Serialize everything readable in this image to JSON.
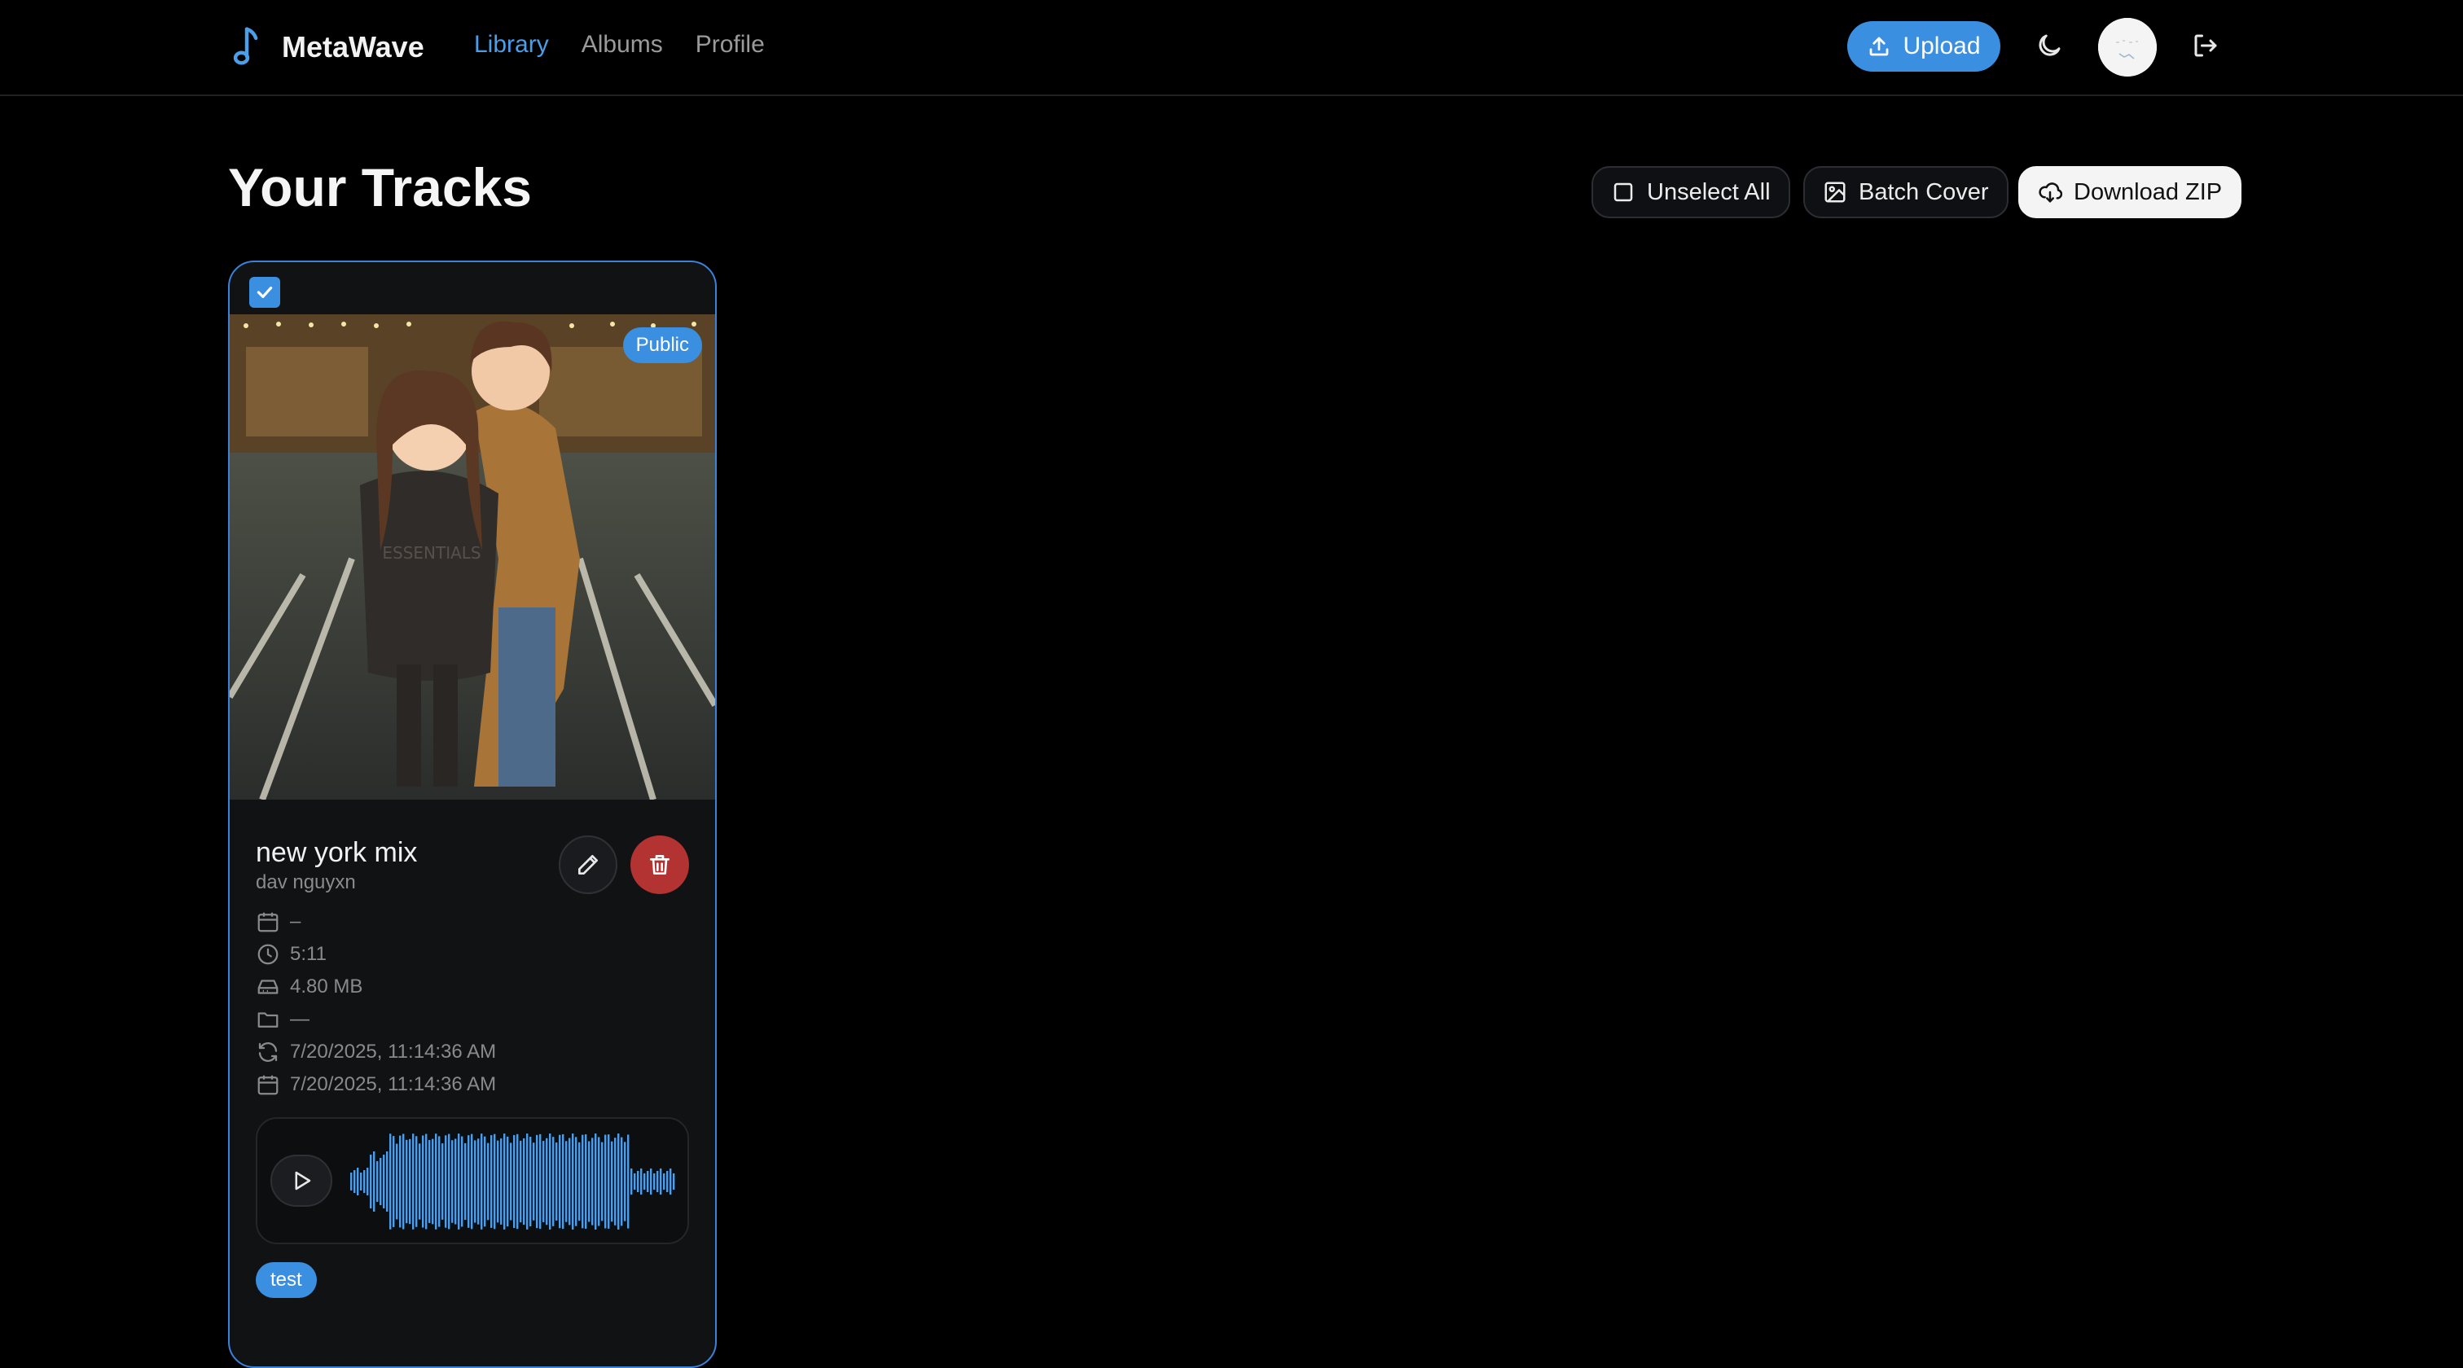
{
  "app": {
    "brand": "MetaWave",
    "accent": "#3b8fe0"
  },
  "nav": {
    "items": [
      {
        "label": "Library",
        "active": true
      },
      {
        "label": "Albums",
        "active": false
      },
      {
        "label": "Profile",
        "active": false
      }
    ]
  },
  "header": {
    "upload_label": "Upload",
    "theme_icon": "moon-icon",
    "logout_icon": "logout-icon"
  },
  "page": {
    "title": "Your Tracks"
  },
  "toolbar": {
    "unselect_label": "Unselect All",
    "batch_cover_label": "Batch Cover",
    "download_zip_label": "Download ZIP"
  },
  "tracks": [
    {
      "selected": true,
      "visibility": "Public",
      "title": "new york mix",
      "artist": "dav nguyxn",
      "release_date": "–",
      "duration": "5:11",
      "size": "4.80 MB",
      "folder": "—",
      "updated": "7/20/2025, 11:14:36 AM",
      "created": "7/20/2025, 11:14:36 AM",
      "tags": [
        "test"
      ],
      "waveform_color": "#4a9eea"
    }
  ]
}
